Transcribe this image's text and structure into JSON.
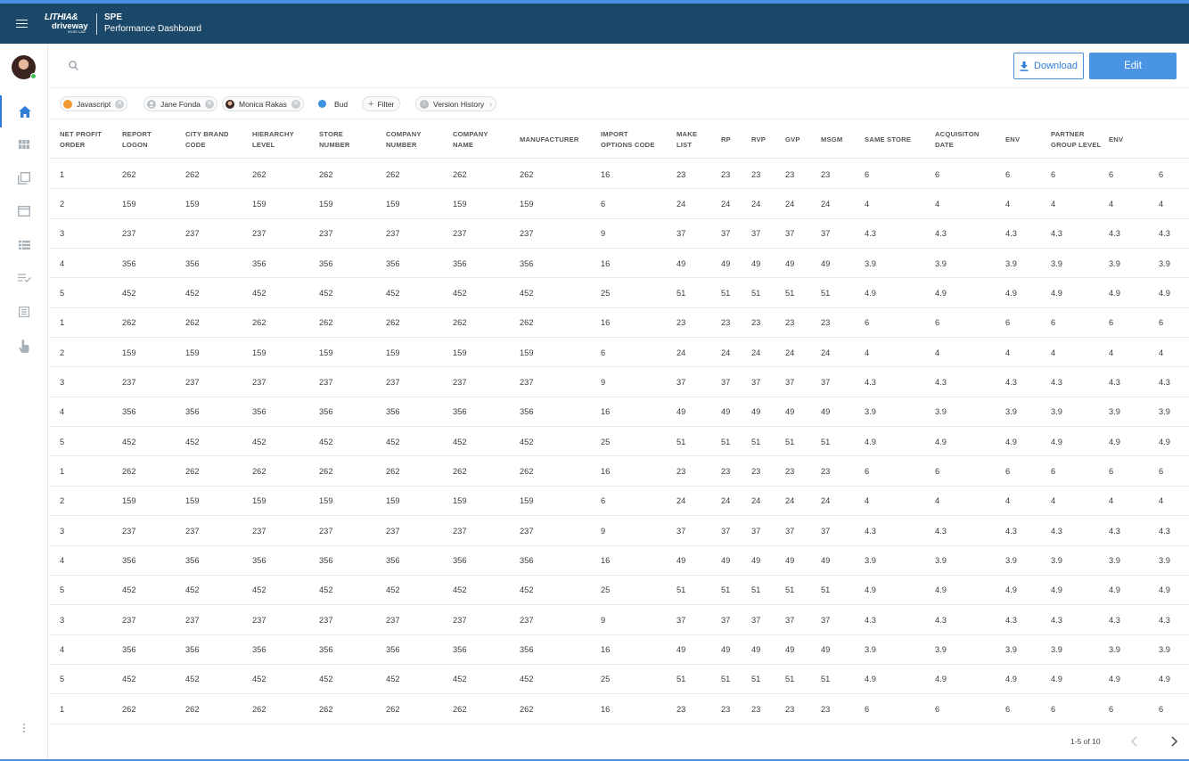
{
  "header": {
    "logo_line1": "LITHIA&",
    "logo_line2": "driveway",
    "logo_line3": "NYSE LAD",
    "title": "SPE",
    "subtitle": "Performance Dashboard"
  },
  "sidebar": {
    "items": [
      {
        "icon": "home-icon",
        "active": true
      },
      {
        "icon": "grid-icon",
        "active": false
      },
      {
        "icon": "copy-icon",
        "active": false
      },
      {
        "icon": "folder-icon",
        "active": false
      },
      {
        "icon": "list-icon",
        "active": false
      },
      {
        "icon": "checklist-icon",
        "active": false
      },
      {
        "icon": "document-list-icon",
        "active": false
      },
      {
        "icon": "touch-icon",
        "active": false
      }
    ]
  },
  "toolbar": {
    "download_label": "Download",
    "edit_label": "Edit"
  },
  "filters": {
    "chips": [
      {
        "label": "Javascript",
        "kind": "tag",
        "color": "#f29a32"
      },
      {
        "label": "Jane Fonda",
        "kind": "user"
      },
      {
        "label": "Monica Rakas",
        "kind": "user-photo"
      },
      {
        "label": "Bud",
        "kind": "tag",
        "color": "#3d8fe0"
      }
    ],
    "filter_label": "Filter",
    "version_label": "Version History"
  },
  "table": {
    "headers": [
      [
        "NET PROFIT",
        "ORDER"
      ],
      [
        "REPORT",
        "LOGON"
      ],
      [
        "CITY BRAND",
        "CODE"
      ],
      [
        "HIERARCHY",
        "LEVEL"
      ],
      [
        "STORE",
        "NUMBER"
      ],
      [
        "COMPANY",
        "NUMBER"
      ],
      [
        "COMPANY",
        "NAME"
      ],
      [
        "MANUFACTURER"
      ],
      [
        "IMPORT",
        "OPTIONS CODE"
      ],
      [
        "MAKE",
        "LIST"
      ],
      [
        "RP"
      ],
      [
        "RVP"
      ],
      [
        "GVP"
      ],
      [
        "MSGM"
      ],
      [
        "SAME STORE"
      ],
      [
        "ACQUISITON",
        "DATE"
      ],
      [
        "ENV"
      ],
      [
        "PARTNER",
        "GROUP LEVEL"
      ],
      [
        "ENV"
      ],
      [
        ""
      ]
    ],
    "rows": [
      [
        "1",
        "262",
        "262",
        "262",
        "262",
        "262",
        "262",
        "262",
        "16",
        "23",
        "23",
        "23",
        "23",
        "23",
        "6",
        "6",
        "6",
        "6",
        "6",
        "6"
      ],
      [
        "2",
        "159",
        "159",
        "159",
        "159",
        "159",
        "159",
        "159",
        "6",
        "24",
        "24",
        "24",
        "24",
        "24",
        "4",
        "4",
        "4",
        "4",
        "4",
        "4"
      ],
      [
        "3",
        "237",
        "237",
        "237",
        "237",
        "237",
        "237",
        "237",
        "9",
        "37",
        "37",
        "37",
        "37",
        "37",
        "4.3",
        "4.3",
        "4.3",
        "4.3",
        "4.3",
        "4.3"
      ],
      [
        "4",
        "356",
        "356",
        "356",
        "356",
        "356",
        "356",
        "356",
        "16",
        "49",
        "49",
        "49",
        "49",
        "49",
        "3.9",
        "3.9",
        "3.9",
        "3.9",
        "3.9",
        "3.9"
      ],
      [
        "5",
        "452",
        "452",
        "452",
        "452",
        "452",
        "452",
        "452",
        "25",
        "51",
        "51",
        "51",
        "51",
        "51",
        "4.9",
        "4.9",
        "4.9",
        "4.9",
        "4.9",
        "4.9"
      ],
      [
        "1",
        "262",
        "262",
        "262",
        "262",
        "262",
        "262",
        "262",
        "16",
        "23",
        "23",
        "23",
        "23",
        "23",
        "6",
        "6",
        "6",
        "6",
        "6",
        "6"
      ],
      [
        "2",
        "159",
        "159",
        "159",
        "159",
        "159",
        "159",
        "159",
        "6",
        "24",
        "24",
        "24",
        "24",
        "24",
        "4",
        "4",
        "4",
        "4",
        "4",
        "4"
      ],
      [
        "3",
        "237",
        "237",
        "237",
        "237",
        "237",
        "237",
        "237",
        "9",
        "37",
        "37",
        "37",
        "37",
        "37",
        "4.3",
        "4.3",
        "4.3",
        "4.3",
        "4.3",
        "4.3"
      ],
      [
        "4",
        "356",
        "356",
        "356",
        "356",
        "356",
        "356",
        "356",
        "16",
        "49",
        "49",
        "49",
        "49",
        "49",
        "3.9",
        "3.9",
        "3.9",
        "3.9",
        "3.9",
        "3.9"
      ],
      [
        "5",
        "452",
        "452",
        "452",
        "452",
        "452",
        "452",
        "452",
        "25",
        "51",
        "51",
        "51",
        "51",
        "51",
        "4.9",
        "4.9",
        "4.9",
        "4.9",
        "4.9",
        "4.9"
      ],
      [
        "1",
        "262",
        "262",
        "262",
        "262",
        "262",
        "262",
        "262",
        "16",
        "23",
        "23",
        "23",
        "23",
        "23",
        "6",
        "6",
        "6",
        "6",
        "6",
        "6"
      ],
      [
        "2",
        "159",
        "159",
        "159",
        "159",
        "159",
        "159",
        "159",
        "6",
        "24",
        "24",
        "24",
        "24",
        "24",
        "4",
        "4",
        "4",
        "4",
        "4",
        "4"
      ],
      [
        "3",
        "237",
        "237",
        "237",
        "237",
        "237",
        "237",
        "237",
        "9",
        "37",
        "37",
        "37",
        "37",
        "37",
        "4.3",
        "4.3",
        "4.3",
        "4.3",
        "4.3",
        "4.3"
      ],
      [
        "4",
        "356",
        "356",
        "356",
        "356",
        "356",
        "356",
        "356",
        "16",
        "49",
        "49",
        "49",
        "49",
        "49",
        "3.9",
        "3.9",
        "3.9",
        "3.9",
        "3.9",
        "3.9"
      ],
      [
        "5",
        "452",
        "452",
        "452",
        "452",
        "452",
        "452",
        "452",
        "25",
        "51",
        "51",
        "51",
        "51",
        "51",
        "4.9",
        "4.9",
        "4.9",
        "4.9",
        "4.9",
        "4.9"
      ],
      [
        "3",
        "237",
        "237",
        "237",
        "237",
        "237",
        "237",
        "237",
        "9",
        "37",
        "37",
        "37",
        "37",
        "37",
        "4.3",
        "4.3",
        "4.3",
        "4.3",
        "4.3",
        "4.3"
      ],
      [
        "4",
        "356",
        "356",
        "356",
        "356",
        "356",
        "356",
        "356",
        "16",
        "49",
        "49",
        "49",
        "49",
        "49",
        "3.9",
        "3.9",
        "3.9",
        "3.9",
        "3.9",
        "3.9"
      ],
      [
        "5",
        "452",
        "452",
        "452",
        "452",
        "452",
        "452",
        "452",
        "25",
        "51",
        "51",
        "51",
        "51",
        "51",
        "4.9",
        "4.9",
        "4.9",
        "4.9",
        "4.9",
        "4.9"
      ],
      [
        "1",
        "262",
        "262",
        "262",
        "262",
        "262",
        "262",
        "262",
        "16",
        "23",
        "23",
        "23",
        "23",
        "23",
        "6",
        "6",
        "6",
        "6",
        "6",
        "6"
      ]
    ]
  },
  "pagination": {
    "label": "1-5 of 10"
  },
  "colors": {
    "header_bg": "#1b4868",
    "accent": "#4a94e4",
    "active_nav": "#2f7dd4"
  }
}
